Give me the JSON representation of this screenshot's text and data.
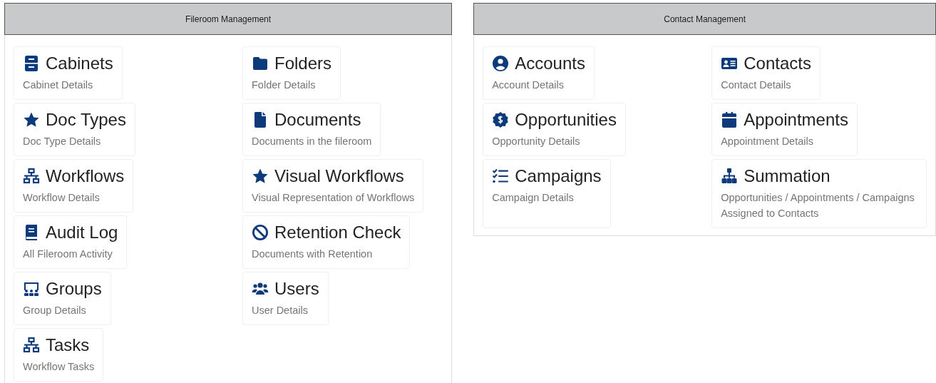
{
  "panels": [
    {
      "title": "Fileroom Management",
      "items": [
        {
          "title": "Cabinets",
          "subtitle": "Cabinet Details"
        },
        {
          "title": "Folders",
          "subtitle": "Folder Details"
        },
        {
          "title": "Doc Types",
          "subtitle": "Doc Type Details"
        },
        {
          "title": "Documents",
          "subtitle": "Documents in the fileroom"
        },
        {
          "title": "Workflows",
          "subtitle": "Workflow Details"
        },
        {
          "title": "Visual Workflows",
          "subtitle": "Visual Representation of Workflows"
        },
        {
          "title": "Audit Log",
          "subtitle": "All Fileroom Activity"
        },
        {
          "title": "Retention Check",
          "subtitle": "Documents with Retention"
        },
        {
          "title": "Groups",
          "subtitle": "Group Details"
        },
        {
          "title": "Users",
          "subtitle": "User Details"
        },
        {
          "title": "Tasks",
          "subtitle": "Workflow Tasks"
        }
      ]
    },
    {
      "title": "Contact Management",
      "items": [
        {
          "title": "Accounts",
          "subtitle": "Account Details"
        },
        {
          "title": "Contacts",
          "subtitle": "Contact Details"
        },
        {
          "title": "Opportunities",
          "subtitle": "Opportunity Details"
        },
        {
          "title": "Appointments",
          "subtitle": "Appointment Details"
        },
        {
          "title": "Campaigns",
          "subtitle": "Campaign Details"
        },
        {
          "title": "Summation",
          "subtitle": "Opportunities / Appointments / Campaigns Assigned to Contacts"
        }
      ]
    }
  ]
}
